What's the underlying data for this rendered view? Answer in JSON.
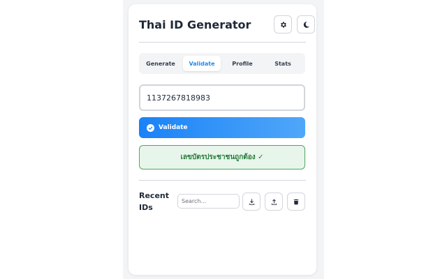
{
  "app": {
    "title": "Thai ID Generator"
  },
  "header": {
    "settings_icon": "gear-icon",
    "theme_icon": "moon-icon"
  },
  "tabs": [
    {
      "label": "Generate",
      "active": false
    },
    {
      "label": "Validate",
      "active": true
    },
    {
      "label": "Profile",
      "active": false
    },
    {
      "label": "Stats",
      "active": false
    }
  ],
  "validate": {
    "id_value": "1137267818983",
    "button_label": "Validate",
    "result_text": "เลขบัตรประชาชนถูกต้อง ✓"
  },
  "recent": {
    "label": "Recent IDs",
    "search_placeholder": "Search...",
    "search_value": ""
  },
  "colors": {
    "accent": "#1d8bf1",
    "success_bg": "#e8f5ea",
    "success_text": "#237a3b"
  }
}
